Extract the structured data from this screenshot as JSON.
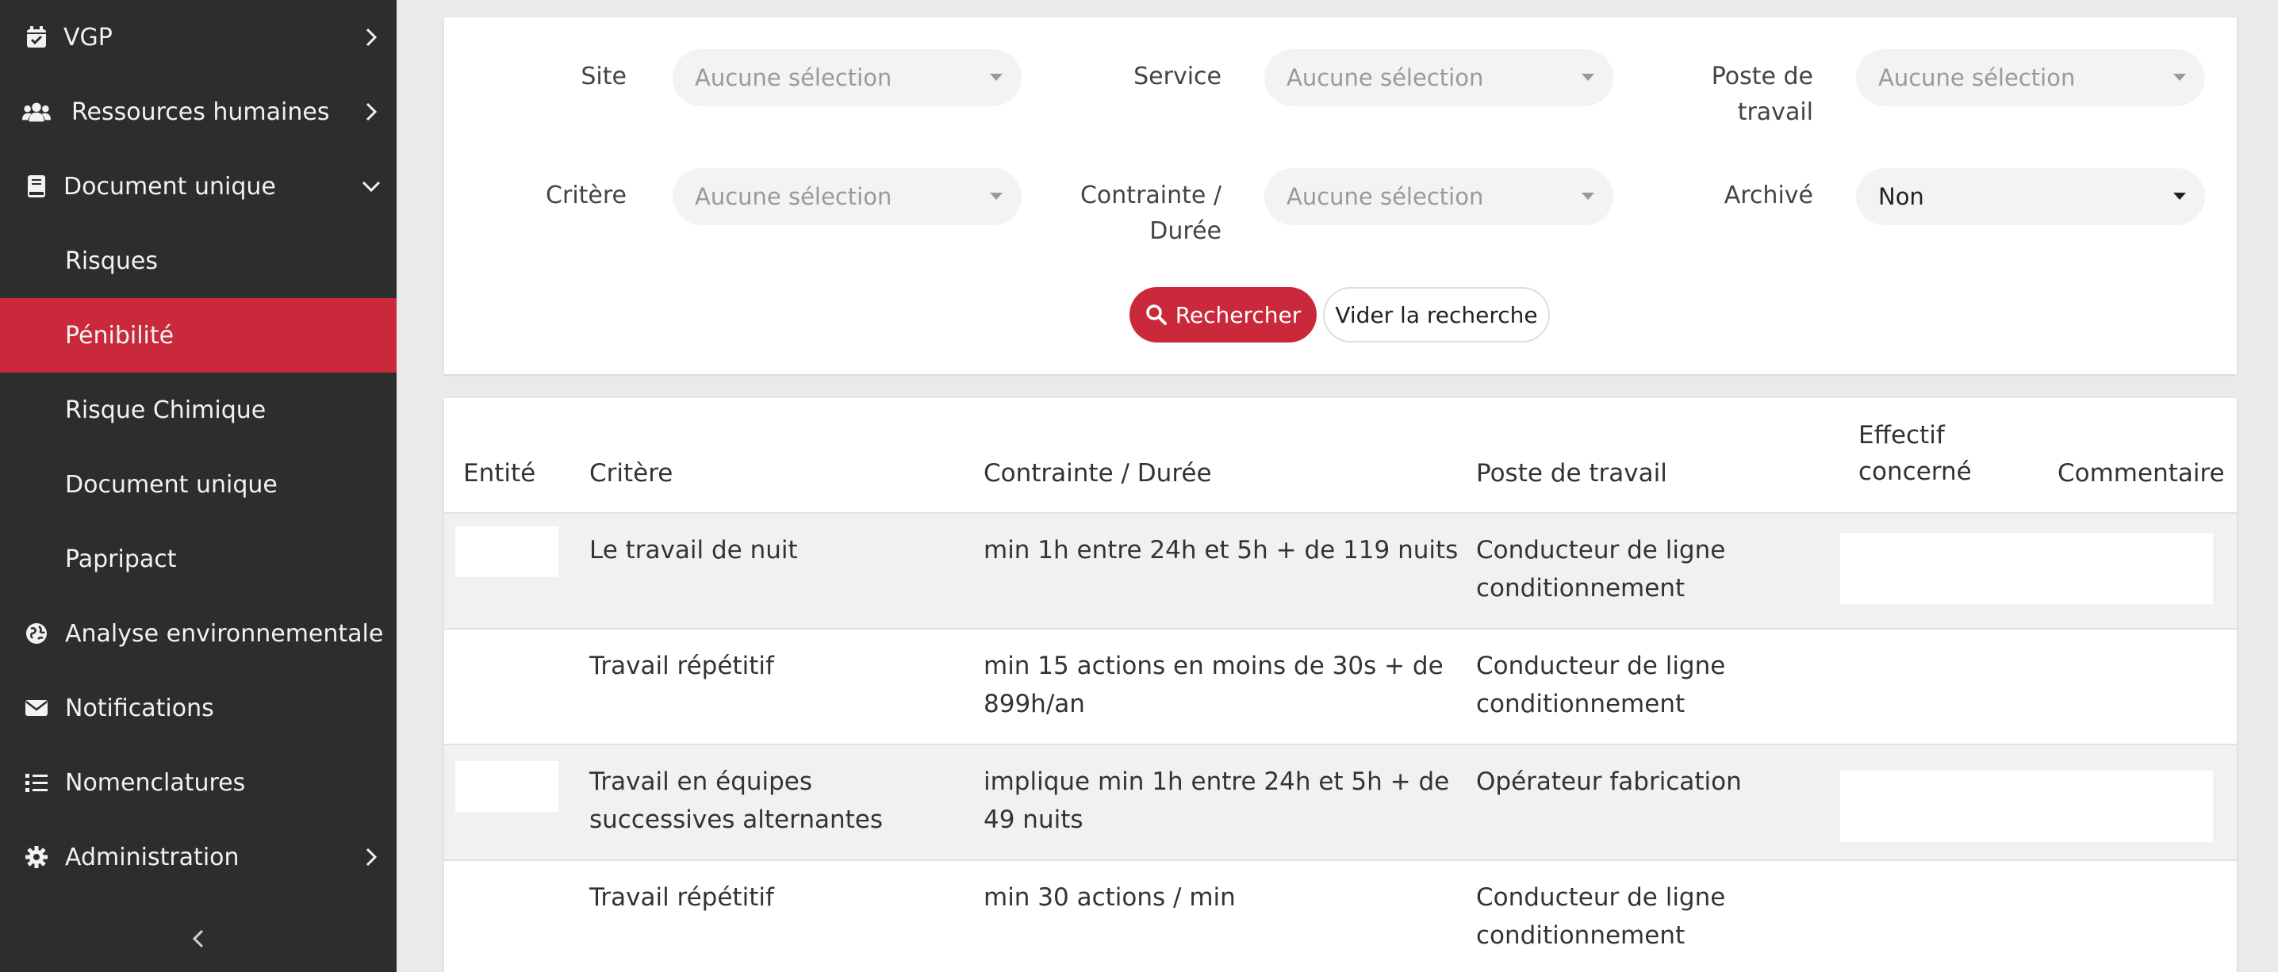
{
  "sidebar": {
    "items": [
      {
        "label": "VGP",
        "icon": "calendar-check-icon"
      },
      {
        "label": "Ressources humaines",
        "icon": "users-icon"
      },
      {
        "label": "Document unique",
        "icon": "book-icon"
      },
      {
        "label": "Risques"
      },
      {
        "label": "Pénibilité"
      },
      {
        "label": "Risque Chimique"
      },
      {
        "label": "Document unique"
      },
      {
        "label": "Papripact"
      },
      {
        "label": "Analyse environnementale",
        "icon": "globe-icon"
      },
      {
        "label": "Notifications",
        "icon": "envelope-icon"
      },
      {
        "label": "Nomenclatures",
        "icon": "list-icon"
      },
      {
        "label": "Administration",
        "icon": "gear-icon"
      }
    ],
    "active_color": "#c9293a"
  },
  "filters": {
    "site": {
      "label": "Site",
      "value": "Aucune sélection"
    },
    "service": {
      "label": "Service",
      "value": "Aucune sélection"
    },
    "poste": {
      "label_line1": "Poste de",
      "label_line2": "travail",
      "value": "Aucune sélection"
    },
    "critere": {
      "label": "Critère",
      "value": "Aucune sélection"
    },
    "contrainte": {
      "label_line1": "Contrainte /",
      "label_line2": "Durée",
      "value": "Aucune sélection"
    },
    "archive": {
      "label": "Archivé",
      "value": "Non"
    },
    "search_label": "Rechercher",
    "clear_label": "Vider la recherche"
  },
  "table": {
    "headers": {
      "entite": "Entité",
      "critere": "Critère",
      "contrainte": "Contrainte / Durée",
      "poste": "Poste de travail",
      "effectif_line1": "Effectif",
      "effectif_line2": "concerné",
      "commentaire": "Commentaire"
    },
    "rows": [
      {
        "critere": [
          "Le travail de nuit"
        ],
        "contrainte": [
          "min 1h entre 24h et 5h + de 119 nuits"
        ],
        "poste": [
          "Conducteur de ligne",
          "conditionnement"
        ]
      },
      {
        "critere": [
          "Travail répétitif"
        ],
        "contrainte": [
          "min 15 actions en moins de 30s + de",
          "899h/an"
        ],
        "poste": [
          "Conducteur de ligne",
          "conditionnement"
        ]
      },
      {
        "critere": [
          "Travail en équipes",
          "successives alternantes"
        ],
        "contrainte": [
          "implique min 1h entre 24h et 5h + de",
          "49 nuits"
        ],
        "poste": [
          "Opérateur fabrication"
        ]
      },
      {
        "critere": [
          "Travail répétitif"
        ],
        "contrainte": [
          "min 30 actions / min"
        ],
        "poste": [
          "Conducteur de ligne",
          "conditionnement"
        ]
      }
    ]
  }
}
